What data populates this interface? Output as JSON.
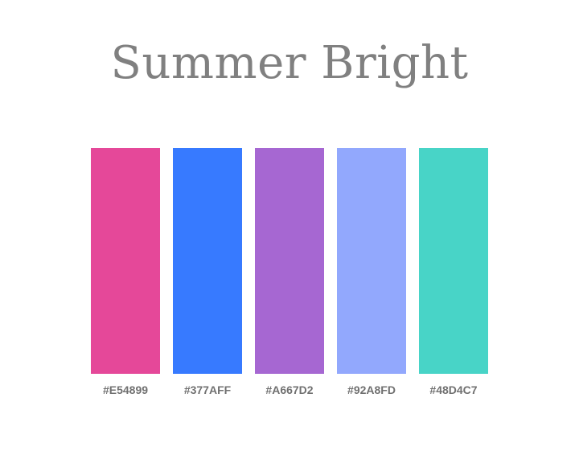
{
  "palette": {
    "title": "Summer Bright",
    "swatches": [
      {
        "label": "#E54899",
        "color": "#E54899"
      },
      {
        "label": "#377AFF",
        "color": "#377AFF"
      },
      {
        "label": "#A667D2",
        "color": "#A667D2"
      },
      {
        "label": "#92A8FD",
        "color": "#92A8FD"
      },
      {
        "label": "#48D4C7",
        "color": "#48D4C7"
      }
    ]
  }
}
